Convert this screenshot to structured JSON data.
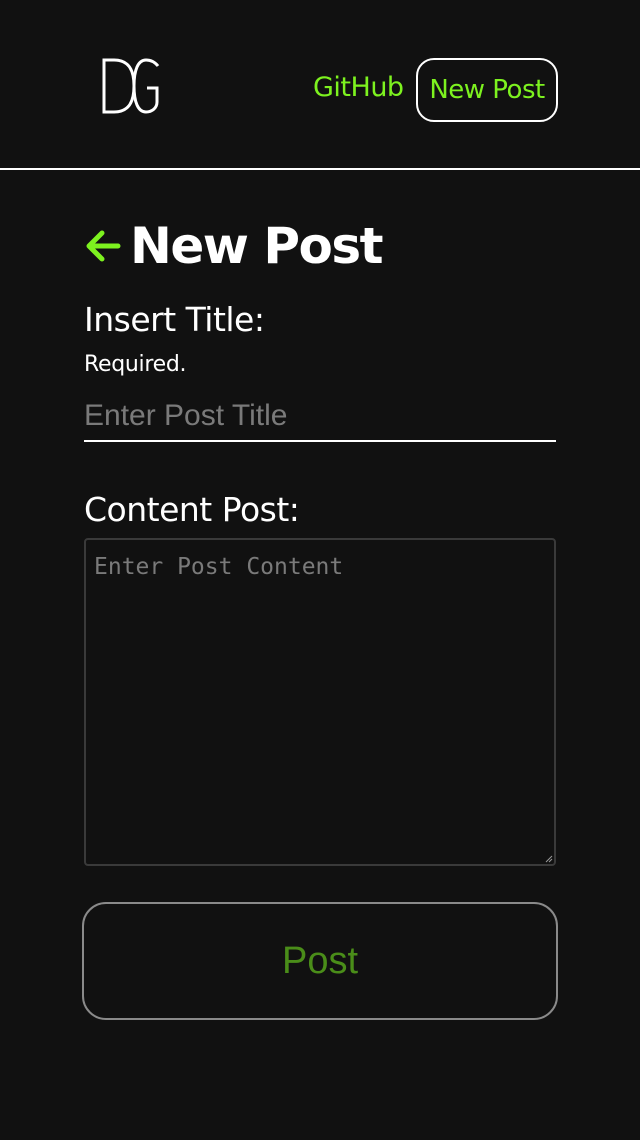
{
  "header": {
    "logo_icon": "dg-monogram-logo",
    "nav": {
      "github_label": "GitHub",
      "new_post_label": "New Post"
    }
  },
  "page": {
    "back_icon": "arrow-left-icon",
    "title": "New Post"
  },
  "form": {
    "title_label": "Insert Title:",
    "title_required_note": "Required.",
    "title_input": {
      "value": "",
      "placeholder": "Enter Post Title"
    },
    "content_label": "Content Post:",
    "content_textarea": {
      "value": "",
      "placeholder": "Enter Post Content"
    },
    "submit_label": "Post"
  },
  "colors": {
    "background": "#111111",
    "accent": "#7df21f",
    "submit_text": "#4a8d19",
    "text": "#ffffff",
    "placeholder": "#7a7a7a"
  }
}
